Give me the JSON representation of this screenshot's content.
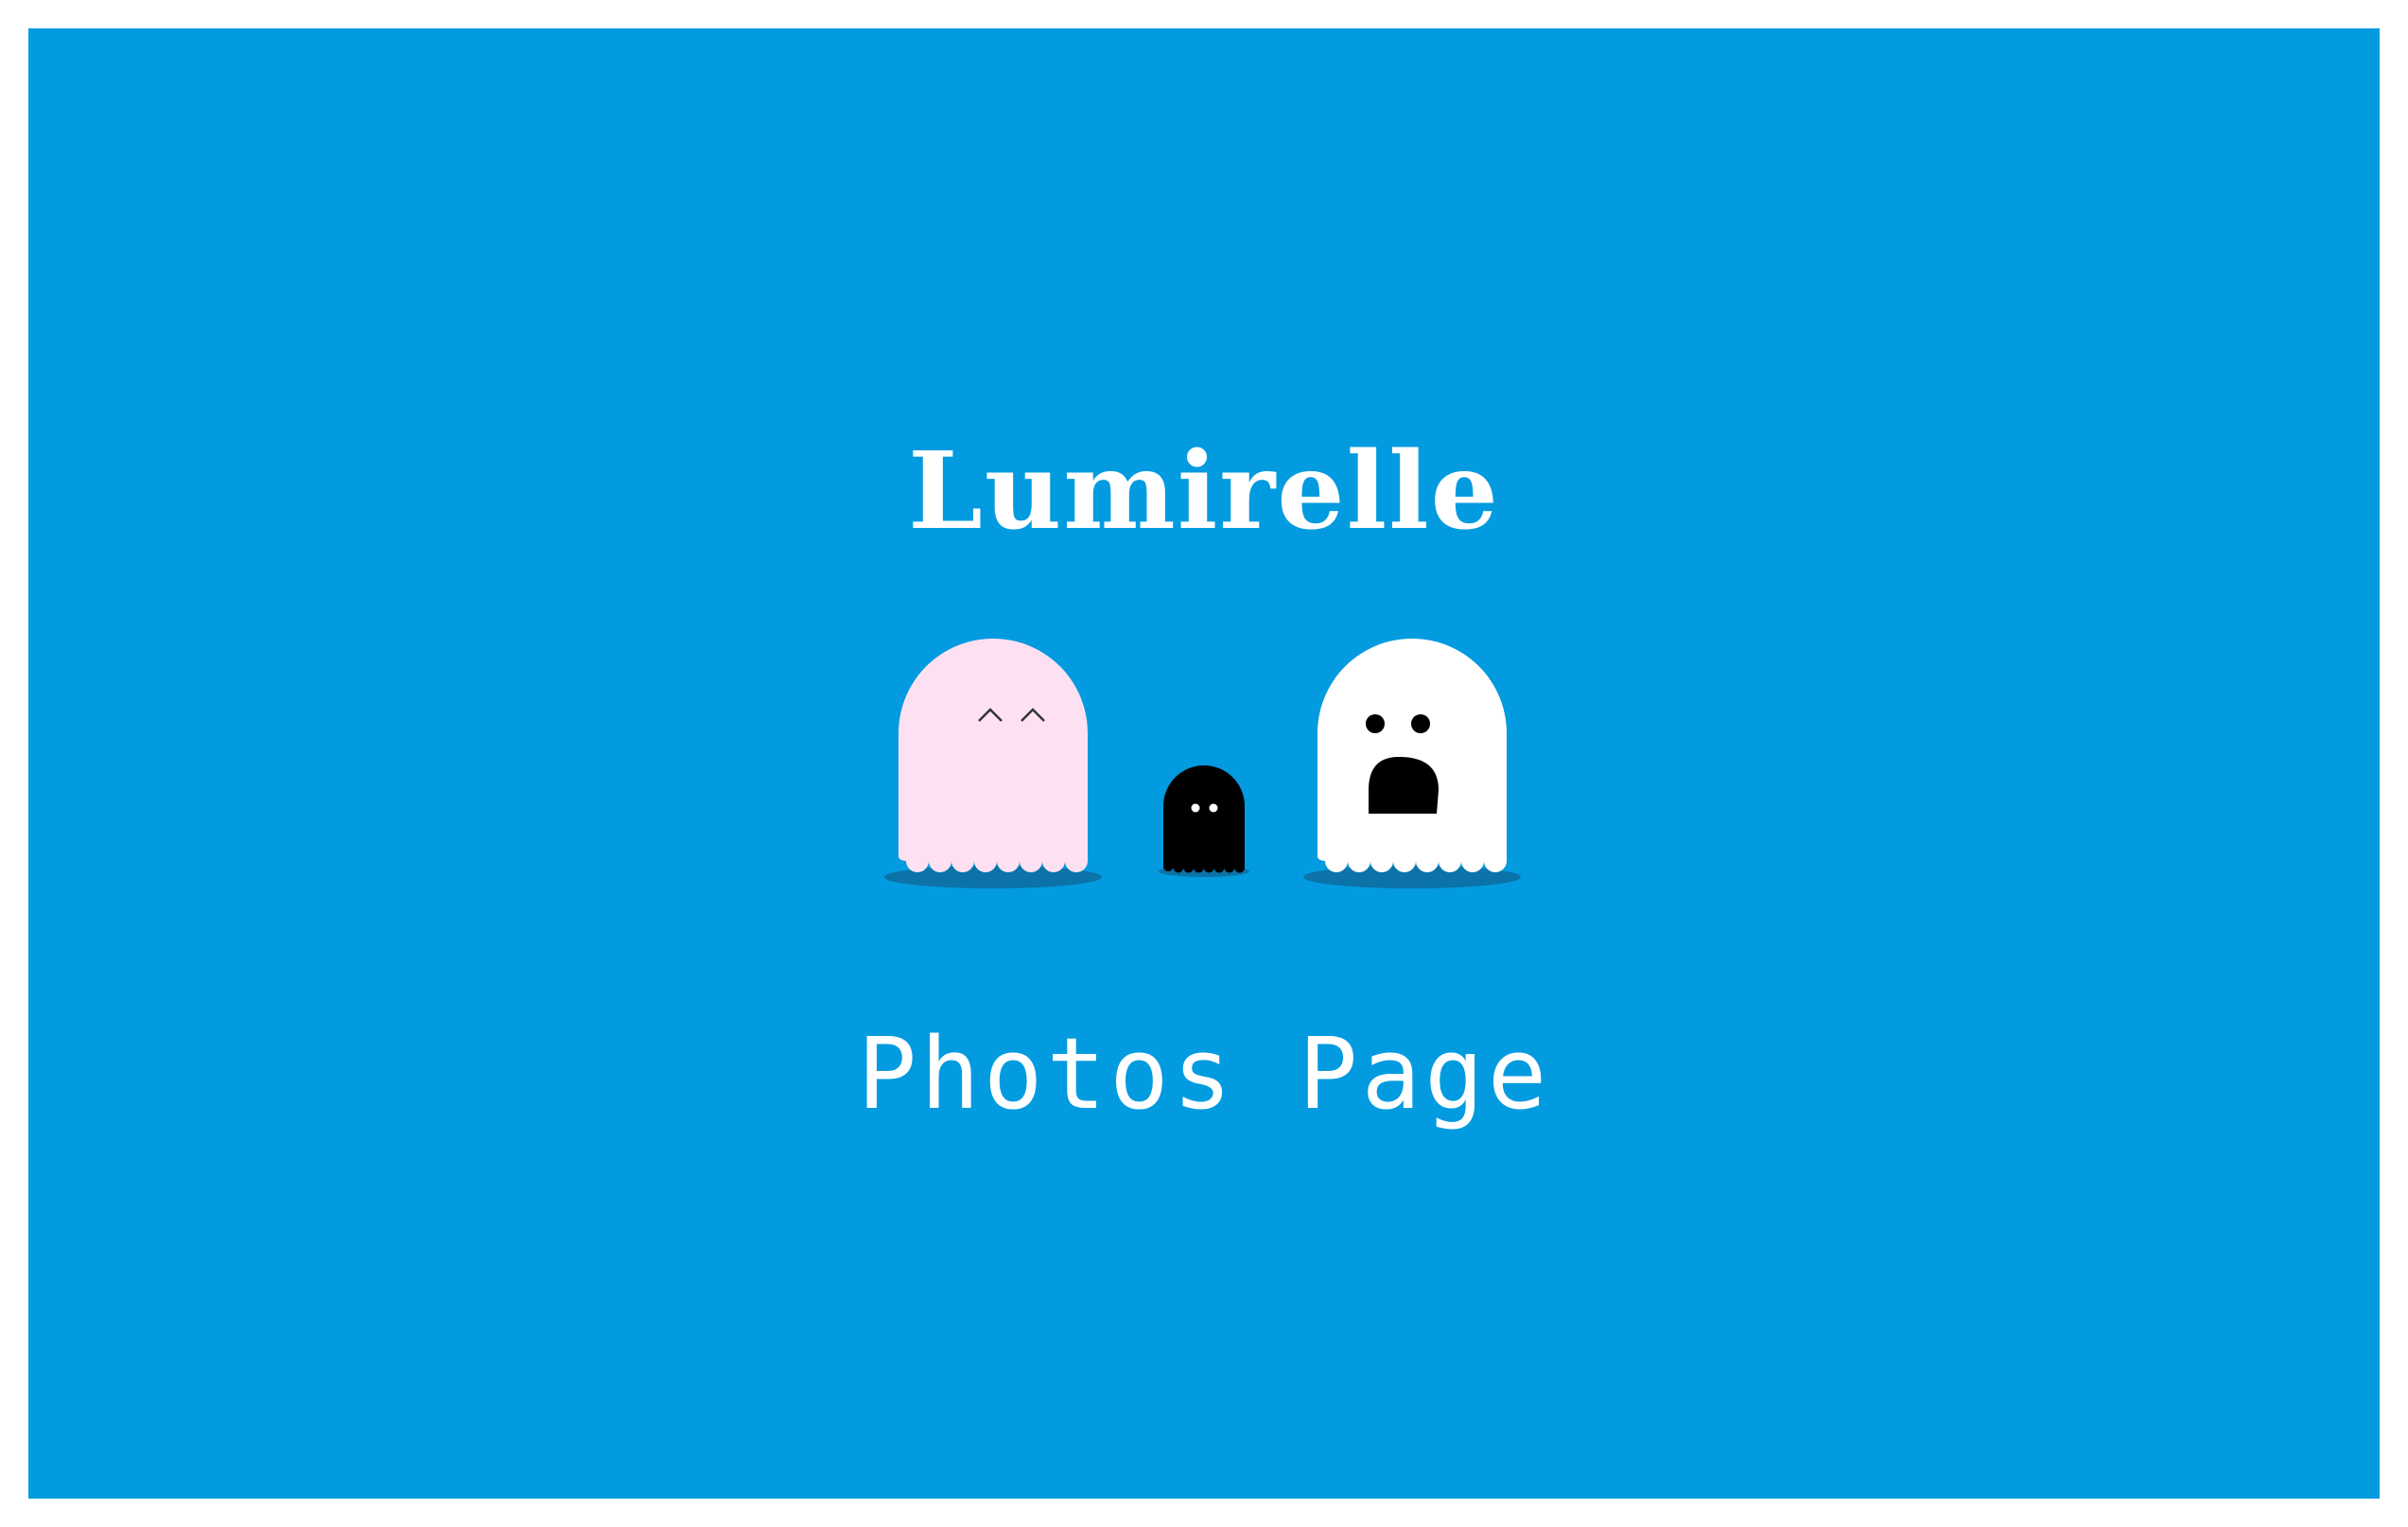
{
  "site": {
    "brand": "Lumirelle",
    "page_title": "Photos Page"
  },
  "colors": {
    "background": "#039be0",
    "page_margin": "#ffffff",
    "pink_ghost": "#fde1f3",
    "black_ghost": "#000000",
    "white_ghost": "#ffffff",
    "shadow": "#0b73a8"
  },
  "illustration": {
    "ghosts": [
      {
        "name": "pink-ghost",
        "expression": "happy-closed-eyes"
      },
      {
        "name": "small-black-ghost",
        "expression": "neutral"
      },
      {
        "name": "white-ghost",
        "expression": "shocked"
      }
    ]
  }
}
